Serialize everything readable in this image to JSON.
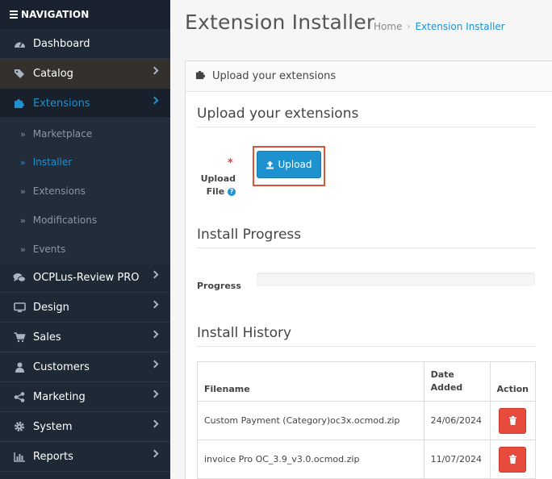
{
  "sidebar": {
    "header": "NAVIGATION",
    "items": {
      "dashboard": "Dashboard",
      "catalog": "Catalog",
      "extensions": "Extensions",
      "ocplus": "OCPLus-Review PRO",
      "design": "Design",
      "sales": "Sales",
      "customers": "Customers",
      "marketing": "Marketing",
      "system": "System",
      "reports": "Reports"
    },
    "sub": {
      "marketplace": "Marketplace",
      "installer": "Installer",
      "extensions": "Extensions",
      "modifications": "Modifications",
      "events": "Events"
    }
  },
  "page": {
    "title": "Extension Installer",
    "breadcrumb": {
      "home": "Home",
      "current": "Extension Installer"
    }
  },
  "panel": {
    "heading": "Upload your extensions",
    "upload_section": "Upload your extensions",
    "upload_label_1": "Upload",
    "upload_label_2": "File",
    "upload_button": "Upload",
    "progress_section": "Install Progress",
    "progress_label": "Progress",
    "progress_value": 0,
    "history_section": "Install History",
    "table": {
      "headers": {
        "filename": "Filename",
        "date_1": "Date",
        "date_2": "Added",
        "action": "Action"
      },
      "rows": [
        {
          "filename": "Custom Payment (Category)oc3x.ocmod.zip",
          "date": "24/06/2024"
        },
        {
          "filename": "invoice Pro OC_3.9_v3.0.ocmod.zip",
          "date": "11/07/2024"
        }
      ]
    }
  },
  "colors": {
    "accent": "#1e91cf",
    "danger": "#e64b3c",
    "sidebar": "#1f2936"
  }
}
